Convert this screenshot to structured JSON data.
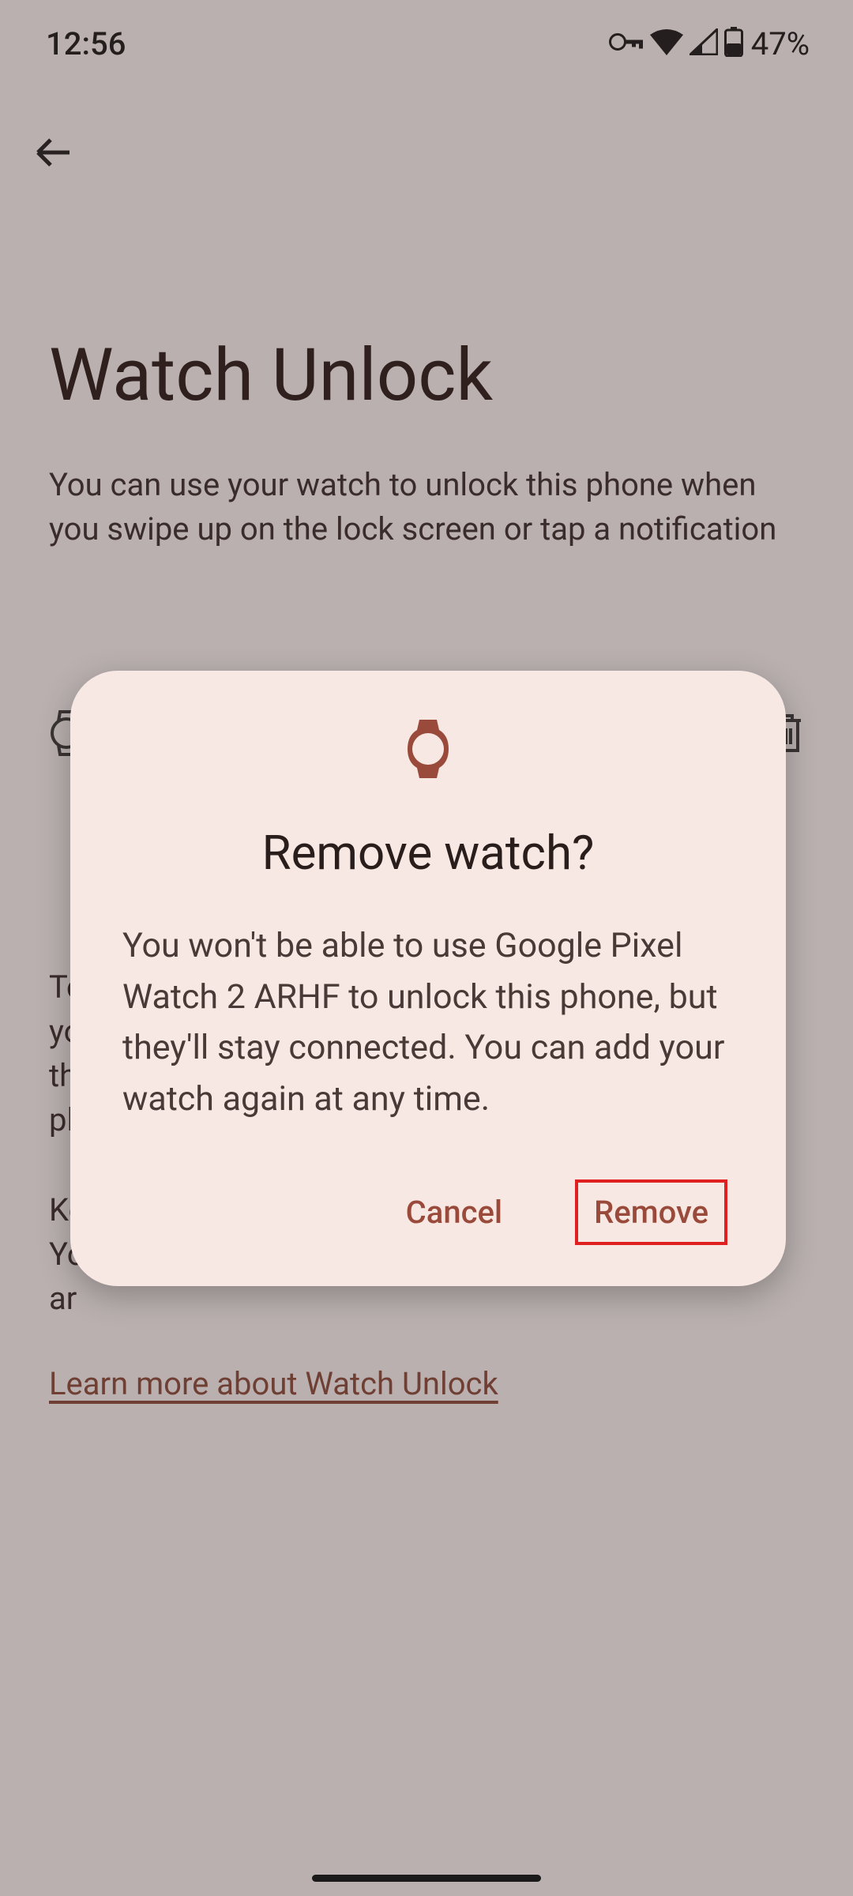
{
  "statusbar": {
    "time": "12:56",
    "battery_text": "47%"
  },
  "page": {
    "title": "Watch Unlock",
    "subtitle": "You can use your watch to unlock this phone when you swipe up on the lock screen or tap a notification",
    "device_name": "Google Pixel Watch 2 ARHF",
    "bg_para1": "To",
    "bg_para1_l2": "yo",
    "bg_para1_l3": "th",
    "bg_para1_l4": "pl",
    "bg_para2_l1": "Ke",
    "bg_para2_l2": "Yo",
    "bg_para2_l3": "ar",
    "learn_more": "Learn more about Watch Unlock"
  },
  "dialog": {
    "title": "Remove watch?",
    "body": "You won't be able to use Google Pixel Watch 2 ARHF to unlock this phone, but they'll stay connected. You can add your watch again at any time.",
    "cancel_label": "Cancel",
    "remove_label": "Remove"
  },
  "colors": {
    "dialog_bg": "#f8e8e3",
    "accent": "#9a4a3a"
  }
}
